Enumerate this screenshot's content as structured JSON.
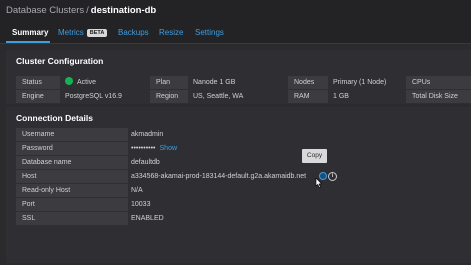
{
  "breadcrumb": {
    "parent": "Database Clusters",
    "separator": "/",
    "current": "destination-db"
  },
  "tabs": [
    {
      "label": "Summary",
      "active": true
    },
    {
      "label": "Metrics",
      "badge": "BETA"
    },
    {
      "label": "Backups"
    },
    {
      "label": "Resize"
    },
    {
      "label": "Settings"
    }
  ],
  "cluster_config": {
    "title": "Cluster Configuration",
    "status_label": "Status",
    "status_value": "Active",
    "plan_label": "Plan",
    "plan_value": "Nanode 1 GB",
    "nodes_label": "Nodes",
    "nodes_value": "Primary (1 Node)",
    "cpus_label": "CPUs",
    "engine_label": "Engine",
    "engine_value": "PostgreSQL v16.9",
    "region_label": "Region",
    "region_value": "US, Seattle, WA",
    "ram_label": "RAM",
    "ram_value": "1 GB",
    "disk_label": "Total Disk Size"
  },
  "connection": {
    "title": "Connection Details",
    "rows": [
      {
        "label": "Username",
        "value": "akmadmin"
      },
      {
        "label": "Password",
        "value": "••••••••••",
        "link": "Show"
      },
      {
        "label": "Database name",
        "value": "defaultdb"
      },
      {
        "label": "Host",
        "value": "a334568-akamai-prod-183144-default.g2a.akamaidb.net"
      },
      {
        "label": "Read-only Host",
        "value": "N/A"
      },
      {
        "label": "Port",
        "value": "10033"
      },
      {
        "label": "SSL",
        "value": "ENABLED"
      }
    ]
  },
  "tooltip": {
    "text": "Copy"
  },
  "colors": {
    "accent": "#3d9de0",
    "status_active": "#16b152",
    "background": "#2b2b2e"
  }
}
